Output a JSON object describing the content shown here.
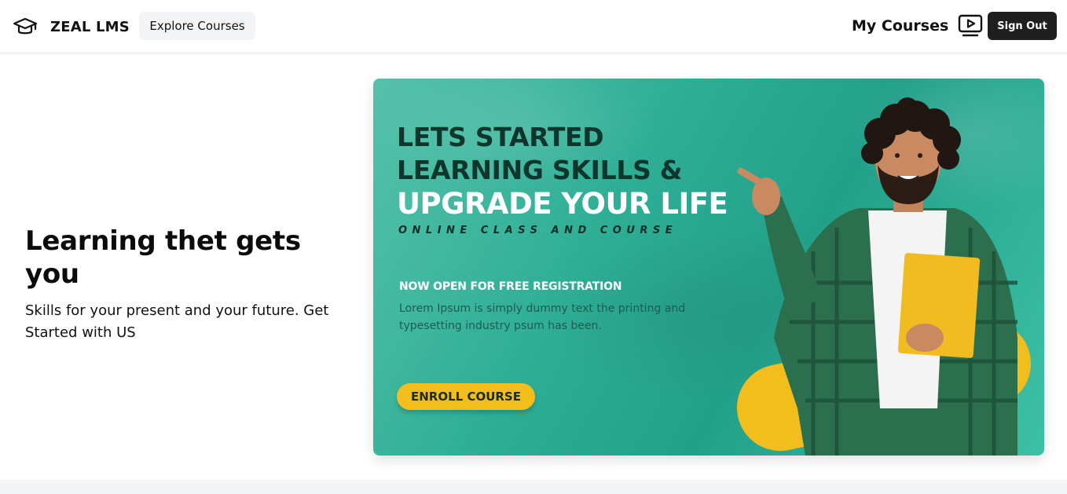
{
  "navbar": {
    "brand_icon": "graduation-cap-icon",
    "brand_name": "ZEAL LMS",
    "explore_label": "Explore Courses",
    "my_courses_label": "My Courses",
    "my_courses_icon": "video-play-icon",
    "sign_out_label": "Sign Out"
  },
  "hero": {
    "title": "Learning thet gets you",
    "subtitle": "Skills for your present and your future. Get Started with US"
  },
  "banner": {
    "line1": "LETS STARTED",
    "line2": "LEARNING SKILLS &",
    "line3": "UPGRADE YOUR LIFE",
    "tagline": "ONLINE CLASS AND COURSE",
    "open_text": "NOW OPEN FOR FREE REGISTRATION",
    "lorem": "Lorem Ipsum is simply dummy text the printing and typesetting industry psum has been.",
    "enroll_label": "ENROLL COURSE",
    "colors": {
      "teal": "#2fae96",
      "accent_yellow": "#f3bd1b",
      "dark_text": "#10352c"
    }
  },
  "colors": {
    "sign_out_bg": "#1f1f1f",
    "explore_bg": "#f3f4f6"
  }
}
